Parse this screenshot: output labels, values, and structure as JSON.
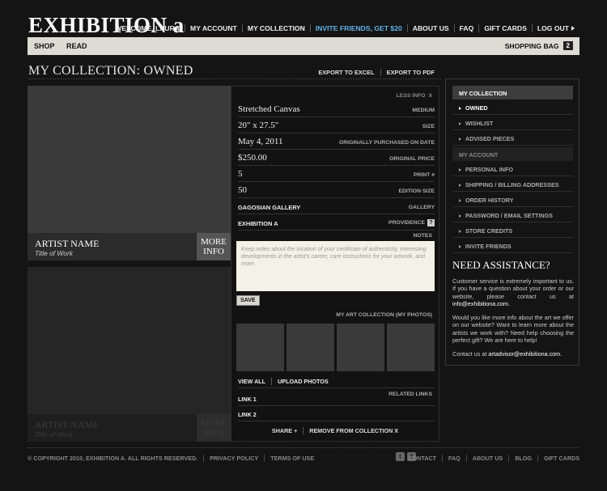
{
  "brand": {
    "logo": "EXHIBITION a"
  },
  "topnav": {
    "welcome": "WELCOME, LAURA",
    "my_account": "MY ACCOUNT",
    "my_collection": "MY COLLECTION",
    "invite": "INVITE FRIENDS, GET $20",
    "about": "ABOUT US",
    "faq": "FAQ",
    "gift_cards": "GIFT CARDS",
    "logout": "LOG OUT"
  },
  "menubar": {
    "shop": "SHOP",
    "read": "READ",
    "bag_label": "SHOPPING BAG",
    "bag_count": "2"
  },
  "page": {
    "title": "MY COLLECTION: OWNED",
    "export_excel": "EXPORT TO EXCEL",
    "export_pdf": "EXPORT TO PDF"
  },
  "artworks": [
    {
      "artist": "ARTIST NAME",
      "title": "Title of Work",
      "more": "MORE INFO"
    },
    {
      "artist": "ARTIST NAME",
      "title": "Title of Work",
      "more": "MORE INFO"
    }
  ],
  "details": {
    "less_info": "LESS INFO",
    "close": "X",
    "rows": [
      {
        "value": "Stretched Canvas",
        "key": "MEDIUM"
      },
      {
        "value": "20\"  x  27.5\"",
        "key": "SIZE"
      },
      {
        "value": "May 4, 2011",
        "key": "ORIGINALLY PURCHASED ON DATE"
      },
      {
        "value": "$250.00",
        "key": "ORIGINAL PRICE"
      },
      {
        "value": "5",
        "key": "PRINT #"
      },
      {
        "value": "50",
        "key": "EDITION SIZE"
      },
      {
        "value": "GAGOSIAN GALLERY",
        "key": "GALLERY"
      },
      {
        "value": "EXHIBITION A",
        "key": "PROVIDENCE"
      }
    ],
    "help_mark": "?",
    "notes_label": "NOTES",
    "notes_placeholder": "Keep notes about the location of your certificate of authenticity, interesting developments in the artist's career, care instructions for your artwork, and more.",
    "save": "SAVE",
    "photos_label": "MY ART COLLECTION (MY PHOTOS)",
    "view_all": "VIEW ALL",
    "upload": "UPLOAD PHOTOS",
    "related_label": "RELATED LINKS",
    "links": [
      "LINK 1",
      "LINK 2"
    ],
    "share": "SHARE +",
    "remove": "REMOVE FROM COLLECTION  X"
  },
  "sidebar": {
    "collection_head": "MY COLLECTION",
    "collection_items": [
      "OWNED",
      "WISHLIST",
      "ADVISED PIECES"
    ],
    "account_head": "MY ACCOUNT",
    "account_items": [
      "PERSONAL INFO",
      "SHIPPING / BILLING ADDRESSES",
      "ORDER HISTORY",
      "PASSWORD / EMAIL SETTINGS",
      "STORE CREDITS",
      "INVITE FRIENDS"
    ],
    "help_title": "NEED ASSISTANCE?",
    "help_p1": "Customer service is extremely important to us. If you have a question about your order or our website, please contact us at",
    "help_email": "info@exhibitiona.com.",
    "help_p2": "Would you like more info about the art we offer on our website? Want to learn more about the artists we work with? Need help choosing the perfect gift? We are here to help!",
    "help_p3": "Contact us at",
    "help_email2": "artadvisor@exhibitiona.com."
  },
  "footer": {
    "copyright": "© COPYRIGHT 2010, EXHIBITION A. ALL RIGHTS RESERVED.",
    "privacy": "PRIVACY POLICY",
    "terms": "TERMS OF USE",
    "nav": [
      "CONTACT",
      "FAQ",
      "ABOUT US",
      "BLOG",
      "GIFT CARDS"
    ],
    "twitter": "t",
    "facebook": "f"
  },
  "colors": {
    "accent": "#5fb3e8",
    "background": "#141414",
    "menubar": "#dcdcd4"
  }
}
